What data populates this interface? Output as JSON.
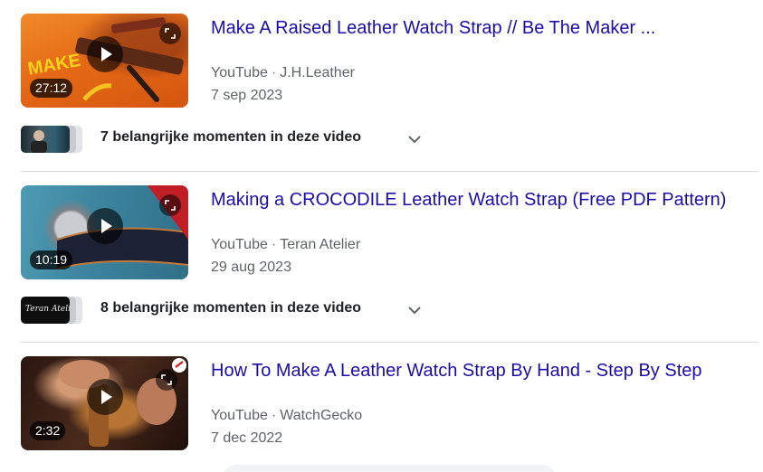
{
  "videos": [
    {
      "title": "Make A Raised Leather Watch Strap // Be The Maker ...",
      "platform": "YouTube",
      "separator": "·",
      "channel": "J.H.Leather",
      "date": "7 sep 2023",
      "duration": "27:12",
      "thumb_text": "MAKE",
      "moments": "7 belangrijke momenten in deze video"
    },
    {
      "title": "Making a CROCODILE Leather Watch Strap (Free PDF Pattern)",
      "platform": "YouTube",
      "separator": "·",
      "channel": "Teran Atelier",
      "date": "29 aug 2023",
      "duration": "10:19",
      "moment_thumb_text": "Teran Atelier",
      "moments": "8 belangrijke momenten in deze video"
    },
    {
      "title": "How To Make A Leather Watch Strap By Hand - Step By Step",
      "platform": "YouTube",
      "separator": "·",
      "channel": "WatchGecko",
      "date": "7 dec 2022",
      "duration": "2:32"
    }
  ],
  "icons": {
    "play": "play-icon",
    "expand": "expand-icon",
    "chevron": "chevron-down-icon"
  },
  "colors": {
    "link": "#1a0dab",
    "meta": "#5f6368",
    "divider": "#dadce0"
  }
}
